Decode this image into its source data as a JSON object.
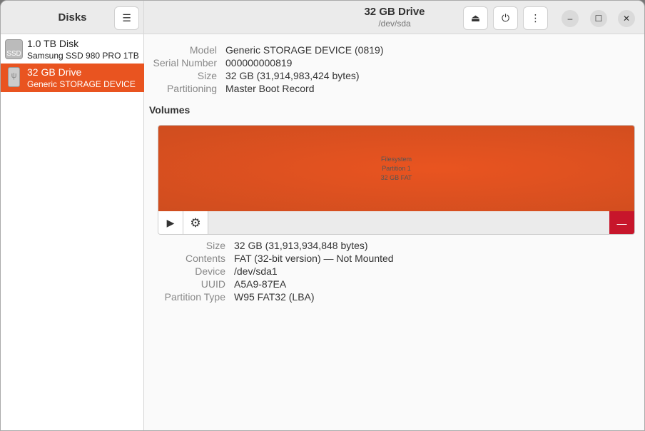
{
  "sidebar": {
    "title": "Disks",
    "items": [
      {
        "name": "1.0 TB Disk",
        "desc": "Samsung SSD 980 PRO 1TB",
        "icon": "ssd-icon",
        "icon_text": "SSD"
      },
      {
        "name": "32 GB Drive",
        "desc": "Generic STORAGE DEVICE",
        "icon": "usb-drive-icon"
      }
    ]
  },
  "header": {
    "title": "32 GB Drive",
    "subtitle": "/dev/sda",
    "eject": "⏏",
    "power": "⏻",
    "more": "⋮",
    "minimize": "–",
    "maximize": "☐",
    "close": "✕",
    "menu": "☰"
  },
  "drive": [
    {
      "label": "Model",
      "value": "Generic STORAGE DEVICE (0819)"
    },
    {
      "label": "Serial Number",
      "value": "000000000819"
    },
    {
      "label": "Size",
      "value": "32 GB (31,914,983,424 bytes)"
    },
    {
      "label": "Partitioning",
      "value": "Master Boot Record"
    }
  ],
  "volumes": {
    "heading": "Volumes",
    "partition": {
      "line1": "Filesystem",
      "line2": "Partition 1",
      "line3": "32 GB FAT"
    },
    "play": "▶",
    "gear": "⚙",
    "delete": "—",
    "accent": "#e95420",
    "danger": "#c7162b"
  },
  "partition": [
    {
      "label": "Size",
      "value": "32 GB (31,913,934,848 bytes)"
    },
    {
      "label": "Contents",
      "value": "FAT (32-bit version) — Not Mounted"
    },
    {
      "label": "Device",
      "value": "/dev/sda1"
    },
    {
      "label": "UUID",
      "value": "A5A9-87EA"
    },
    {
      "label": "Partition Type",
      "value": "W95 FAT32 (LBA)"
    }
  ]
}
